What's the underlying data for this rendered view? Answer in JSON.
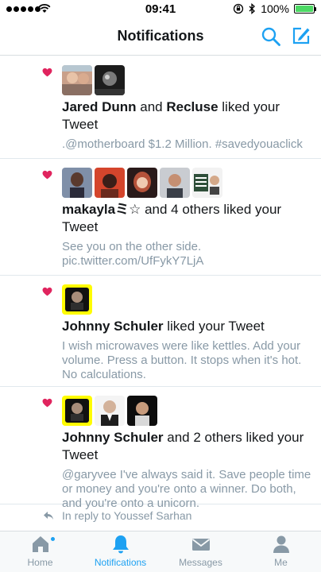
{
  "status_bar": {
    "time": "09:41",
    "battery": "100%",
    "battery_level": 1.0
  },
  "nav": {
    "title": "Notifications",
    "search_icon": "search-icon",
    "compose_icon": "compose-icon"
  },
  "colors": {
    "accent": "#1da1f2",
    "heart": "#e0245e",
    "muted": "#8899a6"
  },
  "notifications": [
    {
      "actor1": "Jared Dunn",
      "connector": " and ",
      "actor2": "Recluse",
      "action": " liked your Tweet",
      "tweet": ".@motherboard $1.2 Million. #savedyouaclick"
    },
    {
      "actor1": "makaylaミ☆",
      "action": " and 4 others liked your Tweet",
      "tweet": "See you on the other side. pic.twitter.com/UfFykY7LjA"
    },
    {
      "actor1": "Johnny Schuler",
      "action": " liked your Tweet",
      "tweet": "I wish microwaves were like kettles. Add your volume. Press a button. It stops when it's hot. No calculations."
    },
    {
      "actor1": "Johnny Schuler",
      "action": " and 2 others liked your Tweet",
      "tweet": "@garyvee I've always said it. Save people time or money and you're onto a winner. Do both, and you're onto a unicorn."
    }
  ],
  "partial_row": {
    "text": "In reply to Youssef Sarhan"
  },
  "tabs": [
    {
      "label": "Home",
      "icon": "home-icon",
      "active": false,
      "badge": true
    },
    {
      "label": "Notifications",
      "icon": "bell-icon",
      "active": true,
      "badge": false
    },
    {
      "label": "Messages",
      "icon": "envelope-icon",
      "active": false,
      "badge": false
    },
    {
      "label": "Me",
      "icon": "person-icon",
      "active": false,
      "badge": false
    }
  ]
}
